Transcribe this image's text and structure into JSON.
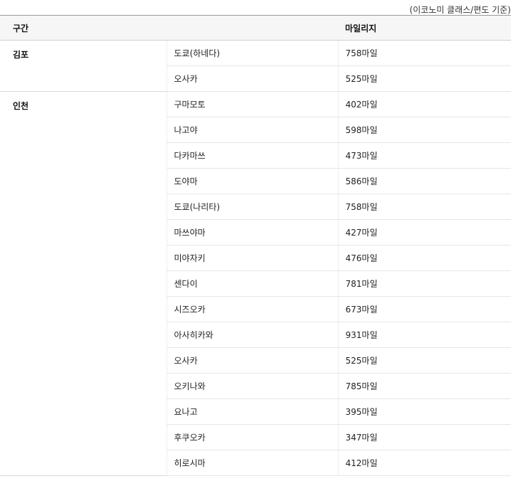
{
  "note": "(이코노미 클래스/편도 기준)",
  "table": {
    "headers": {
      "route": "구간",
      "mileage": "마일리지"
    },
    "groups": [
      {
        "region": "김포",
        "rows": [
          {
            "city": "도쿄(하네다)",
            "mileage": "758마일"
          },
          {
            "city": "오사카",
            "mileage": "525마일"
          }
        ]
      },
      {
        "region": "인천",
        "rows": [
          {
            "city": "구마모토",
            "mileage": "402마일"
          },
          {
            "city": "나고야",
            "mileage": "598마일"
          },
          {
            "city": "다카마쓰",
            "mileage": "473마일"
          },
          {
            "city": "도야마",
            "mileage": "586마일"
          },
          {
            "city": "도쿄(나리타)",
            "mileage": "758마일"
          },
          {
            "city": "마쓰야마",
            "mileage": "427마일"
          },
          {
            "city": "미야자키",
            "mileage": "476마일"
          },
          {
            "city": "센다이",
            "mileage": "781마일"
          },
          {
            "city": "시즈오카",
            "mileage": "673마일"
          },
          {
            "city": "아사히카와",
            "mileage": "931마일"
          },
          {
            "city": "오사카",
            "mileage": "525마일"
          },
          {
            "city": "오키나와",
            "mileage": "785마일"
          },
          {
            "city": "요나고",
            "mileage": "395마일"
          },
          {
            "city": "후쿠오카",
            "mileage": "347마일"
          },
          {
            "city": "히로시마",
            "mileage": "412마일"
          }
        ]
      }
    ]
  }
}
